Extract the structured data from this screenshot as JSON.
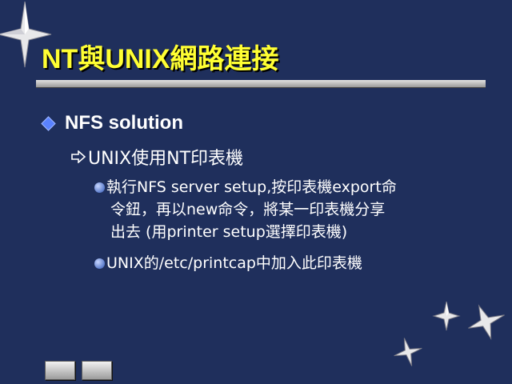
{
  "slide": {
    "title": "NT與UNIX網路連接",
    "level1": {
      "text": "NFS solution"
    },
    "level2": {
      "text": "UNIX使用NT印表機"
    },
    "level3": [
      {
        "line1": "執行NFS server setup,按印表機export命",
        "line2": "令鈕，再以new命令，將某一印表機分享",
        "line3": "出去 (用printer setup選擇印表機)"
      },
      {
        "line1": "UNIX的/etc/printcap中加入此印表機"
      }
    ]
  },
  "navigation": {
    "prev_icon": "nav-prev-button-icon",
    "next_icon": "nav-next-button-icon"
  },
  "colors": {
    "background": "#1f2f5c",
    "title": "#ffff33",
    "text": "#ffffff",
    "bullet": "#5a82ff"
  }
}
